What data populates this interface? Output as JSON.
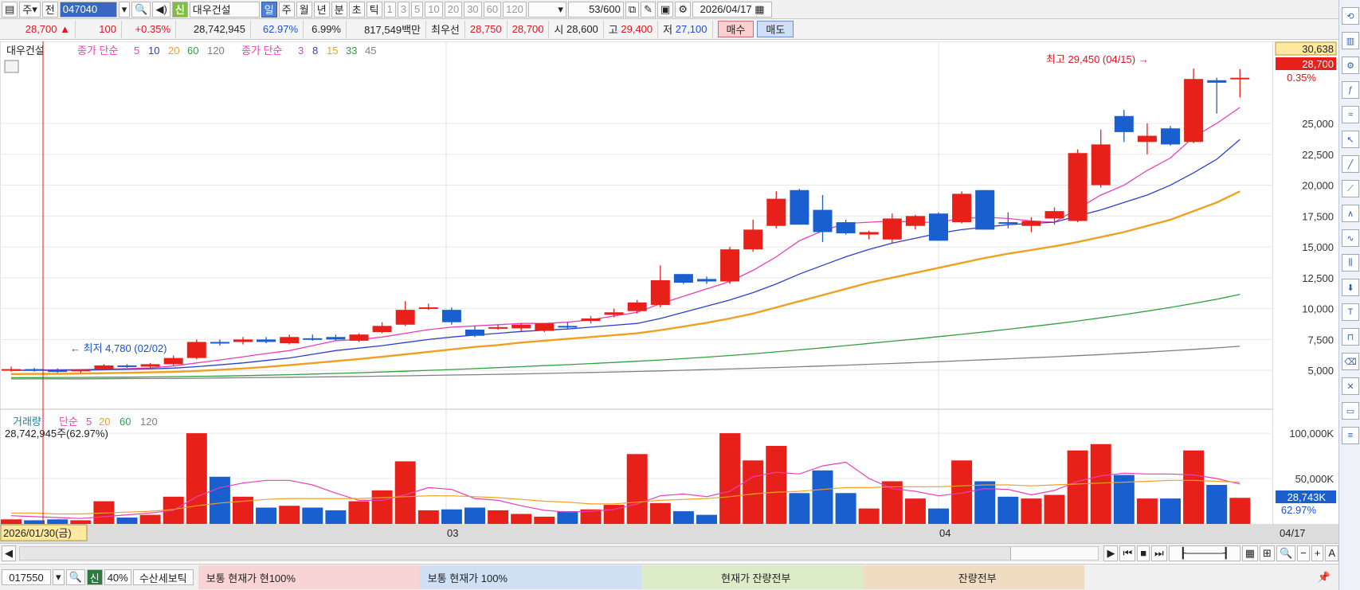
{
  "toolbar": {
    "market": "주",
    "prev_label": "전",
    "code": "047040",
    "new_badge": "신",
    "stock_name": "대우건설",
    "periods": [
      "일",
      "주",
      "월",
      "년",
      "분",
      "초",
      "틱"
    ],
    "period_selected": "일",
    "numbers": [
      "1",
      "3",
      "5",
      "10",
      "20",
      "30",
      "60",
      "120"
    ],
    "count": "53",
    "count_total": "/600",
    "date": "2026/04/17"
  },
  "quote": {
    "price": "28,700",
    "arrow": "▲",
    "change": "100",
    "change_pct": "+0.35%",
    "volume": "28,742,945",
    "vol_ratio": "62.97%",
    "turnover": "6.99%",
    "amount": "817,549백만",
    "pref_label": "최우선",
    "ask": "28,750",
    "bid": "28,700",
    "open_label": "시",
    "open": "28,600",
    "high_label": "고",
    "high": "29,400",
    "low_label": "저",
    "low": "27,100",
    "buy_label": "매수",
    "sell_label": "매도"
  },
  "legend": {
    "name": "대우건설",
    "ma1_label": "종가 단순",
    "ma1_periods": [
      "5",
      "10",
      "20",
      "60",
      "120"
    ],
    "ma2_label": "종가 단순",
    "ma2_periods": [
      "3",
      "8",
      "15",
      "33",
      "45"
    ],
    "vol_label": "거래량",
    "vol_ma_label": "단순",
    "vol_ma_periods": [
      "5",
      "20",
      "60",
      "120"
    ],
    "vol_info": "28,742,945주(62.97%)"
  },
  "annotations": {
    "high": "최고 29,450 (04/15) →",
    "low": "← 최저 4,780 (02/02)"
  },
  "price_box": {
    "top": "30,638",
    "current": "28,700",
    "pct": "0.35%"
  },
  "vol_box": {
    "current": "28,743K",
    "pct": "62.97%"
  },
  "date_axis": {
    "start": "2026/01/30(금)",
    "m03": "03",
    "m04": "04",
    "end": "04/17"
  },
  "bottom": {
    "code": "017550",
    "new_badge": "신",
    "pct": "40%",
    "name": "수산세보틱",
    "pane1": "보통   현재가    현100%",
    "pane2": "보통   현재가     100%",
    "pane3": "현재가     잔량전부",
    "pane4": "잔량전부"
  },
  "colors": {
    "up": "#e8201a",
    "down": "#1a5fd0",
    "ma_pink": "#e93fb5",
    "ma_blue": "#2a3fd0",
    "ma_orange": "#f0a020",
    "ma_green": "#30a040",
    "ma_gray": "#808080"
  },
  "chart_data": {
    "type": "candlestick",
    "y_ticks": [
      5000,
      7500,
      10000,
      12500,
      15000,
      17500,
      20000,
      22500,
      25000
    ],
    "y_tick_labels": [
      "5,000",
      "7,500",
      "10,000",
      "12,500",
      "15,000",
      "17,500",
      "20,000",
      "22,500",
      "25,000"
    ],
    "ylim": [
      2300,
      31000
    ],
    "vol_ticks": [
      50000,
      100000
    ],
    "vol_tick_labels": [
      "50,000K",
      "100,000K"
    ],
    "vol_ylim": [
      0,
      115000
    ],
    "candles": [
      [
        5000,
        5300,
        4900,
        5100,
        5000
      ],
      [
        5100,
        5200,
        4900,
        5000,
        4000
      ],
      [
        5000,
        5150,
        4800,
        4900,
        5000
      ],
      [
        4950,
        5100,
        4780,
        5050,
        4000
      ],
      [
        5100,
        5500,
        5000,
        5400,
        25000
      ],
      [
        5400,
        5500,
        5200,
        5300,
        7000
      ],
      [
        5300,
        5600,
        5200,
        5500,
        10000
      ],
      [
        5500,
        6200,
        5400,
        6000,
        30000
      ],
      [
        6000,
        7500,
        5900,
        7300,
        100000
      ],
      [
        7300,
        7500,
        7000,
        7200,
        52000
      ],
      [
        7300,
        7700,
        7100,
        7500,
        30000
      ],
      [
        7500,
        7700,
        7200,
        7300,
        18000
      ],
      [
        7200,
        7900,
        7100,
        7700,
        20000
      ],
      [
        7600,
        7900,
        7400,
        7500,
        18000
      ],
      [
        7700,
        7900,
        7400,
        7500,
        15000
      ],
      [
        7400,
        8000,
        7300,
        7900,
        25000
      ],
      [
        8100,
        8900,
        8000,
        8600,
        37000
      ],
      [
        8700,
        10600,
        8600,
        9900,
        69000
      ],
      [
        10100,
        10400,
        9900,
        10100,
        15000
      ],
      [
        9900,
        10100,
        8700,
        8900,
        16000
      ],
      [
        8300,
        8600,
        7700,
        7800,
        18000
      ],
      [
        8500,
        8700,
        8300,
        8500,
        15000
      ],
      [
        8400,
        8800,
        8200,
        8700,
        11000
      ],
      [
        8200,
        8800,
        8100,
        8800,
        8000
      ],
      [
        8600,
        8900,
        8400,
        8500,
        14000
      ],
      [
        9000,
        9400,
        8800,
        9200,
        16000
      ],
      [
        9500,
        10000,
        9300,
        9700,
        21000
      ],
      [
        9800,
        10700,
        9600,
        10500,
        77000
      ],
      [
        10300,
        13500,
        10100,
        12300,
        23000
      ],
      [
        12800,
        12800,
        12000,
        12100,
        14000
      ],
      [
        12400,
        12600,
        12000,
        12200,
        10000
      ],
      [
        12200,
        15000,
        12000,
        14800,
        100000
      ],
      [
        14800,
        17200,
        14600,
        16400,
        70000
      ],
      [
        16700,
        19500,
        16500,
        18900,
        86000
      ],
      [
        19600,
        19700,
        16800,
        16800,
        34000
      ],
      [
        18000,
        19200,
        15400,
        16200,
        59000
      ],
      [
        17000,
        17200,
        16000,
        16100,
        34000
      ],
      [
        16000,
        16300,
        15600,
        16200,
        17000
      ],
      [
        15600,
        17700,
        15300,
        17300,
        47000
      ],
      [
        16700,
        17600,
        16400,
        17500,
        28000
      ],
      [
        17700,
        17800,
        15500,
        15500,
        17000
      ],
      [
        17000,
        19500,
        16900,
        19300,
        70000
      ],
      [
        19600,
        19600,
        16400,
        16400,
        47000
      ],
      [
        17000,
        17800,
        16500,
        16900,
        30000
      ],
      [
        16700,
        17400,
        16200,
        17100,
        28000
      ],
      [
        17300,
        18200,
        16800,
        17900,
        32000
      ],
      [
        17100,
        22900,
        17000,
        22600,
        81000
      ],
      [
        20000,
        24500,
        19800,
        23300,
        88000
      ],
      [
        25600,
        26100,
        23500,
        24300,
        54000
      ],
      [
        23500,
        25000,
        22500,
        24000,
        28000
      ],
      [
        24600,
        24800,
        23200,
        23300,
        28000
      ],
      [
        23500,
        29450,
        23400,
        28600,
        81000
      ],
      [
        28500,
        28700,
        25800,
        28300,
        43000
      ],
      [
        28600,
        29400,
        27100,
        28700,
        28743
      ]
    ],
    "ma_lines": [
      {
        "name": "5",
        "color": "#e93fb5",
        "values": [
          5000,
          5040,
          5050,
          5060,
          5100,
          5140,
          5200,
          5350,
          5600,
          5840,
          6100,
          6360,
          6600,
          7000,
          7400,
          7500,
          7700,
          8000,
          8300,
          8500,
          8600,
          8700,
          8800,
          8800,
          8900,
          9100,
          9400,
          9700,
          10400,
          11000,
          11600,
          12200,
          13100,
          14200,
          15500,
          16300,
          16900,
          17000,
          17100,
          17000,
          17000,
          17300,
          17400,
          17300,
          17100,
          17000,
          18100,
          19200,
          20000,
          21200,
          22200,
          23900,
          25000,
          26300
        ]
      },
      {
        "name": "10",
        "color": "#2a3fd0",
        "values": [
          5000,
          5000,
          5010,
          5020,
          5050,
          5080,
          5120,
          5180,
          5300,
          5450,
          5600,
          5800,
          6000,
          6300,
          6600,
          6800,
          7000,
          7250,
          7500,
          7700,
          7850,
          8000,
          8150,
          8250,
          8350,
          8500,
          8650,
          8800,
          9200,
          9700,
          10200,
          10700,
          11300,
          12000,
          12800,
          13500,
          14200,
          14800,
          15300,
          15700,
          16100,
          16400,
          16600,
          16800,
          16900,
          17000,
          17500,
          18000,
          18600,
          19200,
          20000,
          21000,
          22100,
          23700
        ]
      },
      {
        "name": "20",
        "color": "#f0a020",
        "values": [
          4700,
          4710,
          4720,
          4740,
          4770,
          4800,
          4840,
          4880,
          4950,
          5050,
          5150,
          5280,
          5420,
          5580,
          5750,
          5920,
          6100,
          6300,
          6500,
          6700,
          6900,
          7050,
          7250,
          7400,
          7550,
          7700,
          7850,
          8000,
          8250,
          8550,
          8850,
          9200,
          9600,
          10100,
          10600,
          11100,
          11600,
          12100,
          12500,
          12900,
          13300,
          13700,
          14100,
          14450,
          14750,
          15050,
          15400,
          15800,
          16200,
          16700,
          17200,
          17900,
          18600,
          19500
        ]
      },
      {
        "name": "60",
        "color": "#30a040",
        "values": [
          4400,
          4410,
          4420,
          4430,
          4440,
          4450,
          4470,
          4490,
          4510,
          4540,
          4570,
          4610,
          4650,
          4700,
          4750,
          4810,
          4870,
          4930,
          5000,
          5070,
          5140,
          5220,
          5300,
          5380,
          5460,
          5550,
          5640,
          5740,
          5840,
          5950,
          6070,
          6200,
          6340,
          6500,
          6660,
          6830,
          7000,
          7180,
          7360,
          7540,
          7730,
          7920,
          8120,
          8330,
          8540,
          8760,
          9000,
          9250,
          9520,
          9800,
          10100,
          10420,
          10760,
          11150
        ]
      },
      {
        "name": "120",
        "color": "#808080",
        "values": [
          4300,
          4305,
          4310,
          4315,
          4320,
          4330,
          4340,
          4350,
          4360,
          4380,
          4400,
          4420,
          4440,
          4460,
          4480,
          4500,
          4530,
          4560,
          4590,
          4620,
          4650,
          4680,
          4710,
          4750,
          4790,
          4830,
          4870,
          4910,
          4960,
          5010,
          5060,
          5110,
          5170,
          5230,
          5290,
          5350,
          5420,
          5490,
          5560,
          5630,
          5700,
          5780,
          5860,
          5940,
          6020,
          6100,
          6190,
          6280,
          6380,
          6480,
          6590,
          6700,
          6820,
          6950
        ]
      }
    ],
    "vol_ma": [
      {
        "name": "5",
        "color": "#e93fb5",
        "values": [
          9000,
          8000,
          7000,
          6000,
          8000,
          10000,
          12000,
          15000,
          30000,
          40000,
          45000,
          48000,
          48000,
          43000,
          34000,
          26000,
          26000,
          32000,
          40000,
          38000,
          28000,
          26000,
          20000,
          15000,
          13000,
          14000,
          16000,
          22000,
          31000,
          33000,
          30000,
          36000,
          52000,
          57000,
          55000,
          64000,
          68000,
          50000,
          39000,
          36000,
          31000,
          34000,
          39000,
          38000,
          32000,
          37000,
          47000,
          53000,
          56000,
          55000,
          55000,
          54000,
          50000,
          44000
        ]
      },
      {
        "name": "20",
        "color": "#f0a020",
        "values": [
          12000,
          12000,
          11000,
          11000,
          12000,
          13000,
          14000,
          16000,
          20000,
          23000,
          25000,
          27000,
          28000,
          28000,
          28000,
          28000,
          29000,
          30000,
          31000,
          31000,
          30000,
          29000,
          27000,
          25000,
          24000,
          22000,
          22000,
          24000,
          26000,
          27000,
          28000,
          30000,
          33000,
          35000,
          36000,
          38000,
          40000,
          40000,
          41000,
          41000,
          41000,
          42000,
          43000,
          43000,
          42000,
          43000,
          44000,
          45000,
          46000,
          47000,
          48000,
          48000,
          47000,
          46000
        ]
      }
    ]
  }
}
